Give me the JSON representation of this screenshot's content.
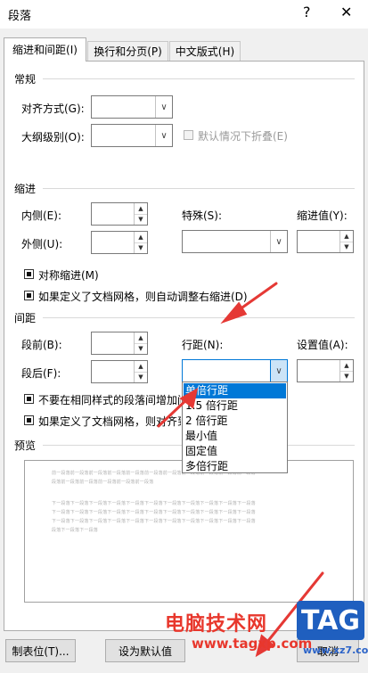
{
  "dialog": {
    "title": "段落",
    "help_label": "?",
    "close_label": "✕"
  },
  "tabs": [
    {
      "label": "缩进和间距(I)"
    },
    {
      "label": "换行和分页(P)"
    },
    {
      "label": "中文版式(H)"
    }
  ],
  "general": {
    "heading": "常规",
    "alignment_label": "对齐方式(G):",
    "alignment_value": "",
    "outline_label": "大纲级别(O):",
    "outline_value": "",
    "collapse_label": "默认情况下折叠(E)"
  },
  "indent": {
    "heading": "缩进",
    "inside_label": "内侧(E):",
    "outside_label": "外侧(U):",
    "inside_value": "",
    "outside_value": "",
    "special_label": "特殊(S):",
    "special_value": "",
    "indent_by_label": "缩进值(Y):",
    "indent_by_value": "",
    "mirror_label": "对称缩进(M)",
    "auto_right_label": "如果定义了文档网格，则自动调整右缩进(D)"
  },
  "spacing": {
    "heading": "间距",
    "before_label": "段前(B):",
    "after_label": "段后(F):",
    "before_value": "",
    "after_value": "",
    "line_spacing_label": "行距(N):",
    "line_spacing_value": "",
    "at_label": "设置值(A):",
    "at_value": "",
    "no_space_label": "不要在相同样式的段落间增加间",
    "snap_grid_label": "如果定义了文档网格，则对齐到"
  },
  "line_spacing_options": [
    "单倍行距",
    "1.5 倍行距",
    "2 倍行距",
    "最小值",
    "固定值",
    "多倍行距"
  ],
  "preview": {
    "heading": "预览",
    "prev_line": "前一段落前一段落前一段落前一段落前一段落前一段落前一段落前一段落前一段落前一段落前一段落",
    "prev_line_short": "段落前一段落前一段落前一段落前一段落前一段落",
    "next_line": "下一段落下一段落下一段落下一段落下一段落下一段落下一段落下一段落下一段落下一段落下一段落",
    "next_line_short": "段落下一段落下一段落"
  },
  "buttons": {
    "tabs": "制表位(T)...",
    "set_default": "设为默认值",
    "cancel": "取消"
  },
  "watermark": {
    "text": "电脑技术网",
    "url": "www.tagxp.com",
    "logo": "TAG",
    "url2": "www.xz7.com"
  },
  "colors": {
    "selection": "#0078d7",
    "annotation_arrow": "#e53935"
  }
}
